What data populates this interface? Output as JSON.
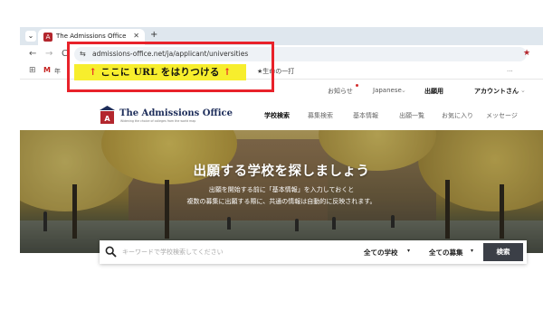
{
  "browser": {
    "tab_title": "The Admissions Office",
    "tab_close": "✕",
    "new_tab": "+",
    "url": "admissions-office.net/ja/applicant/universities",
    "bookmark_truncated": "年",
    "bookmark_right": "★生命の一打",
    "bookmark_more": "..."
  },
  "annotation": {
    "arrow_left": "↑",
    "text": "ここに URL をはりつける",
    "arrow_right": "↑",
    "color": "#e8222a",
    "label_bg": "#f7ee2d"
  },
  "utility": {
    "notice": "お知らせ",
    "language": "Japanese",
    "language_chevron": "⌄",
    "applicant": "出願用",
    "account": "アカウントさん",
    "account_chevron": "⌄"
  },
  "header": {
    "logo_name": "The Admissions Office",
    "logo_tagline": "Widening the choice of colleges from the world map",
    "nav": [
      "学校検索",
      "募集検索",
      "基本情報",
      "出願一覧",
      "お気に入り",
      "メッセージ"
    ]
  },
  "hero": {
    "title": "出願する学校を探しましょう",
    "sub1": "出願を開始する前に「基本情報」を入力しておくと",
    "sub2": "複数の募集に出願する際に、共通の情報は自動的に反映されます。"
  },
  "search": {
    "placeholder": "キーワードで学校検索してください",
    "school_dropdown": "全ての学校",
    "recruit_dropdown": "全ての募集",
    "button": "検索"
  },
  "colors": {
    "brand_navy": "#1d2d5a",
    "brand_red": "#b3262d",
    "search_button": "#3b3f47"
  }
}
